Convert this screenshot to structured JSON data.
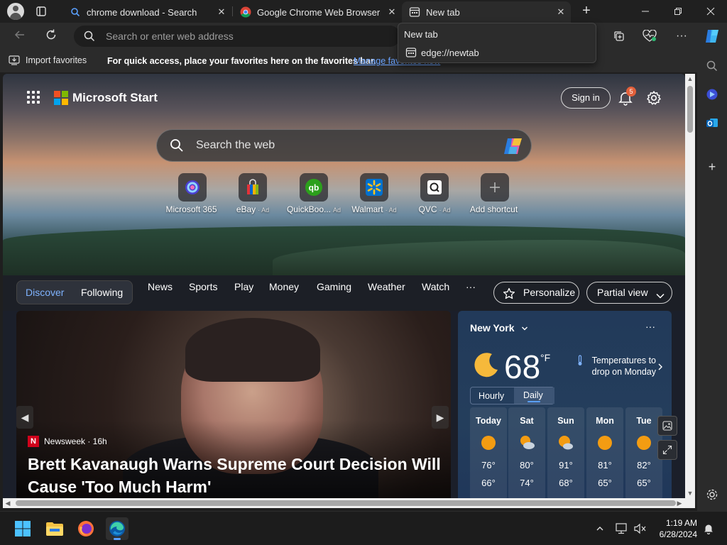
{
  "tabs": [
    {
      "title": "chrome download - Search"
    },
    {
      "title": "Google Chrome Web Browser"
    },
    {
      "title": "New tab"
    }
  ],
  "tooltip": {
    "title": "New tab",
    "url": "edge://newtab"
  },
  "address": {
    "placeholder": "Search or enter web address"
  },
  "favorites": {
    "import_label": "Import favorites",
    "message": "For quick access, place your favorites here on the favorites bar.",
    "manage_link": "Manage favorites now"
  },
  "start": {
    "brand": "Microsoft Start",
    "signin": "Sign in",
    "notification_count": "5",
    "search_placeholder": "Search the web",
    "shortcuts": [
      {
        "label": "Microsoft 365",
        "ad": ""
      },
      {
        "label": "eBay",
        "ad": "· Ad"
      },
      {
        "label": "QuickBoo...",
        "ad": "Ad"
      },
      {
        "label": "Walmart",
        "ad": "· Ad"
      },
      {
        "label": "QVC",
        "ad": "· Ad"
      },
      {
        "label": "Add shortcut",
        "ad": ""
      }
    ]
  },
  "feed_nav": {
    "discover": "Discover",
    "following": "Following",
    "links": [
      "News",
      "Sports",
      "Play",
      "Money",
      "Gaming",
      "Weather",
      "Watch",
      "···"
    ],
    "personalize": "Personalize",
    "partial_view": "Partial view"
  },
  "news": {
    "source": "Newsweek · 16h",
    "source_letter": "N",
    "headline": "Brett Kavanaugh Warns Supreme Court Decision Will Cause 'Too Much Harm'"
  },
  "weather": {
    "city": "New York",
    "temperature": "68",
    "unit": "°F",
    "note": "Temperatures to drop on Monday",
    "tab_hourly": "Hourly",
    "tab_daily": "Daily",
    "days": [
      {
        "name": "Today",
        "hi": "76°",
        "lo": "66°",
        "icon": "sun"
      },
      {
        "name": "Sat",
        "hi": "80°",
        "lo": "74°",
        "icon": "partly-cloudy"
      },
      {
        "name": "Sun",
        "hi": "91°",
        "lo": "68°",
        "icon": "partly-cloudy"
      },
      {
        "name": "Mon",
        "hi": "81°",
        "lo": "65°",
        "icon": "sun"
      },
      {
        "name": "Tue",
        "hi": "82°",
        "lo": "65°",
        "icon": "sun"
      }
    ]
  },
  "taskbar": {
    "time": "1:19 AM",
    "date": "6/28/2024"
  },
  "colors": {
    "accent": "#5aa0ff",
    "link": "#6aa3ff",
    "badge": "#e3603b"
  }
}
